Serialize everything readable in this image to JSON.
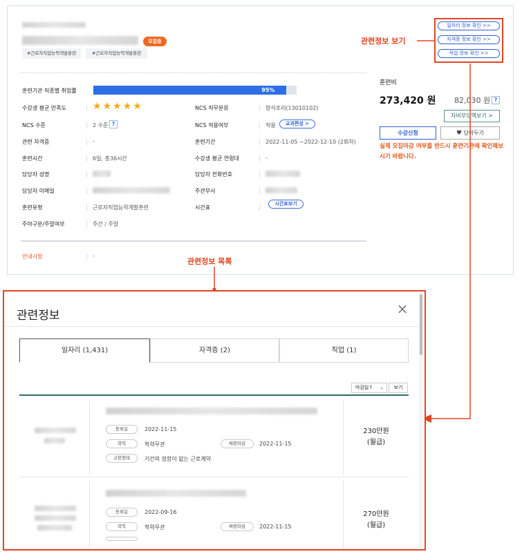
{
  "course": {
    "badge": "모집중",
    "tags": [
      "#근로자직업능력개발훈련",
      "#근로자직업능력개발훈련"
    ],
    "employment_rate_label": "훈련기관 직종별 취업률",
    "employment_rate_value": 95,
    "employment_rate_text": "95%",
    "satisfaction_label": "수강생 평균 만족도",
    "satisfaction_stars": 5,
    "ncs_level_label": "NCS 수준",
    "ncs_level_value": "2 수준",
    "ncs_help": "?",
    "cert_label": "관련 자격증",
    "cert_value": "-",
    "hours_label": "훈련시간",
    "hours_value": "6일, 총36시간",
    "manager_name_label": "담당자 성명",
    "manager_email_label": "담당자 이메일",
    "type_label": "훈련유형",
    "type_value": "근로자직업능력개발훈련",
    "weekday_label": "주야구분/주말여부",
    "weekday_value": "주간 / 주말",
    "ncs_category_label": "NCS 직무분류",
    "ncs_category_value": "양식조리(13010102)",
    "ncs_apply_label": "NCS 적용여부",
    "ncs_apply_value": "적용",
    "ncs_curriculum_btn": "교과편성 >",
    "period_label": "훈련기간",
    "period_value": "2022-11-05 ~2022-12-10 (2회차)",
    "age_label": "수강생 평균 연령대",
    "age_value": "-",
    "manager_phone_label": "담당자 전화번호",
    "dept_label": "주관부서",
    "timetable_label": "시간표",
    "timetable_btn": "시간표보기",
    "notice_label": "안내사항",
    "notice_value": "-"
  },
  "side": {
    "fee_label": "훈련비",
    "fee_value": "273,420 원",
    "fee_secondary": "82,030 원",
    "fee_help": "?",
    "self_pay_btn": "자비부담액보기 >",
    "apply_btn": "수강신청",
    "save_btn": "담아두기",
    "warning": "실제 모집마감 여부를 반드시 훈련기관에 확인해보시기 바랍니다."
  },
  "info_buttons": {
    "job": "일자리 정보 확인 >>",
    "cert": "자격증 정보 확인 >>",
    "occupation": "직업 정보 확인 >>"
  },
  "annotations": {
    "related_view": "관련정보 보기",
    "related_list": "관련정보 목록"
  },
  "modal": {
    "title": "관련정보",
    "close": "×",
    "tabs": [
      "일자리 (1,431)",
      "자격증 (2)",
      "직업 (1)"
    ],
    "sort_label": "마감일↑",
    "view_btn": "보기",
    "rows": [
      {
        "reg_label": "등록일",
        "reg_date": "2022-11-15",
        "edu_label": "학력",
        "edu_value": "학력무관",
        "deadline_label": "채용마감",
        "deadline_value": "2022-11-15",
        "emp_label": "고용형태",
        "emp_value": "기간의 정함이 없는 근로계약",
        "salary": "230만원",
        "salary_unit": "(월급)"
      },
      {
        "reg_label": "등록일",
        "reg_date": "2022-09-16",
        "edu_label": "학력",
        "edu_value": "학력무관",
        "deadline_label": "채용마감",
        "deadline_value": "2022-11-15",
        "salary": "270만원",
        "salary_unit": "(월급)"
      }
    ]
  },
  "colors": {
    "accent_blue": "#2f6ee6",
    "annotation_red": "#e24421",
    "badge_orange": "#f0681d",
    "star": "#f4a914",
    "teal": "#2c6d6d"
  }
}
